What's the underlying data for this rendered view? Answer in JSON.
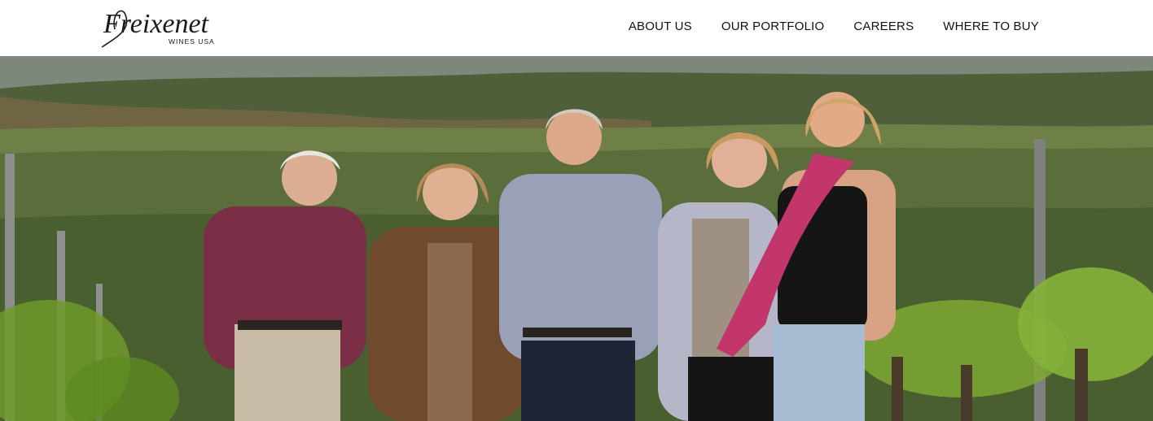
{
  "brand": {
    "name": "Freixenet",
    "tagline": "WINES USA"
  },
  "nav": {
    "items": [
      {
        "label": "ABOUT US"
      },
      {
        "label": "OUR PORTFOLIO"
      },
      {
        "label": "CAREERS"
      },
      {
        "label": "WHERE TO BUY"
      }
    ]
  },
  "hero": {
    "image_icon": "family-in-vineyard-photo"
  }
}
